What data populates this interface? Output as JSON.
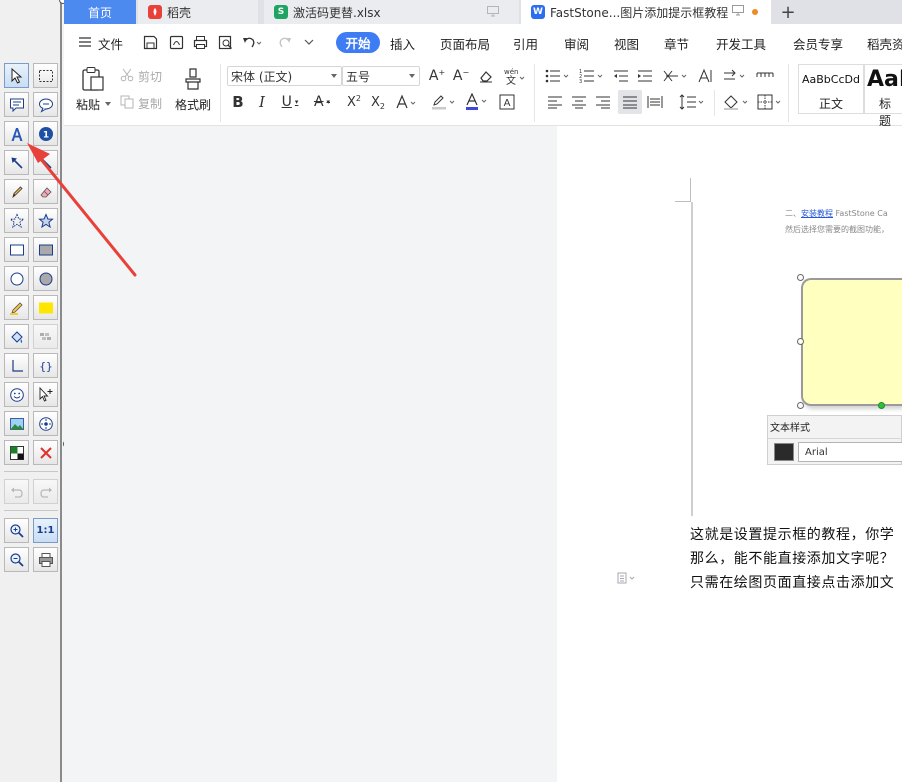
{
  "tabs": [
    {
      "label": "首页"
    },
    {
      "label": "稻壳"
    },
    {
      "label": "激活码更替.xlsx"
    },
    {
      "label": "FastStone...图片添加提示框教程"
    }
  ],
  "menu": {
    "file": "文件",
    "start": "开始",
    "items": [
      "插入",
      "页面布局",
      "引用",
      "审阅",
      "视图",
      "章节",
      "开发工具",
      "会员专享",
      "稻壳资"
    ]
  },
  "ribbon": {
    "paste": "粘贴",
    "cut": "剪切",
    "copy": "复制",
    "format_painter": "格式刷",
    "font_name": "宋体 (正文)",
    "font_size": "五号",
    "style_normal_preview": "AaBbCcDd",
    "style_normal": "正文",
    "style_heading_preview": "AaI",
    "style_heading": "标题"
  },
  "embedded": {
    "line1_prefix": "二、",
    "line1_link": "安装教程",
    "line1_rest": " FastStone Ca",
    "line2": "然后选择您需要的截图功能，",
    "textstyle_title": "文本样式",
    "font_value": "Arial"
  },
  "body_text": [
    "这就是设置提示框的教程，你学",
    "那么，能不能直接添加文字呢？",
    "只需在绘图页面直接点击添加文"
  ],
  "colors": {
    "accent": "#3d7cf3",
    "arrow": "#e8413a",
    "callout_fill": "#ffffc0"
  }
}
